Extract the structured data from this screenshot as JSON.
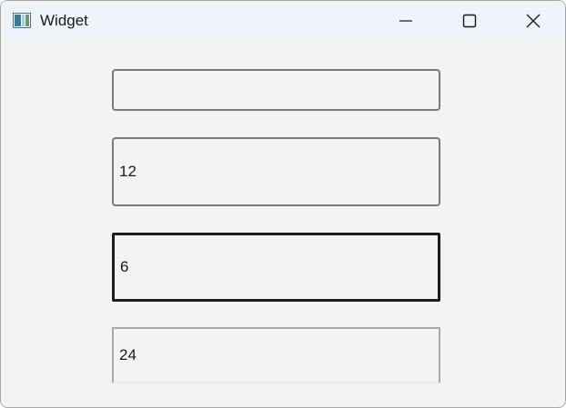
{
  "window": {
    "title": "Widget",
    "controls": {
      "minimize_icon": "minimize-icon",
      "maximize_icon": "maximize-icon",
      "close_icon": "close-icon"
    }
  },
  "fields": [
    {
      "value": ""
    },
    {
      "value": "12"
    },
    {
      "value": "6"
    },
    {
      "value": "24"
    }
  ],
  "colors": {
    "titlebar": "#eff3fa",
    "client": "#f3f3f3",
    "focused_border": "#1c1c1c",
    "border": "#7a7a7a"
  }
}
